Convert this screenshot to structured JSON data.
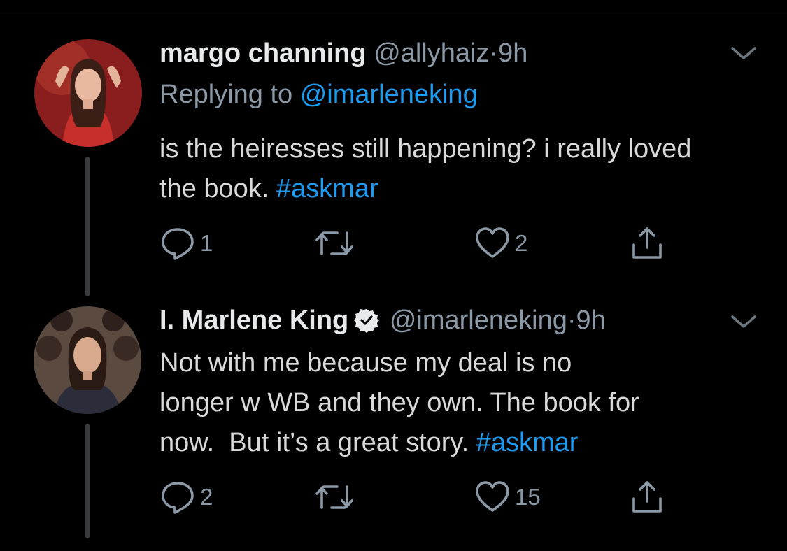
{
  "tweets": [
    {
      "name": "margo channing",
      "handle": "@allyhaiz",
      "sep": "·",
      "time": "9h",
      "replying_prefix": "Replying to",
      "replying_to": "@imarleneking",
      "text": "is the heiresses still happening? i really loved the book.",
      "hashtag": "#askmar",
      "replies": "1",
      "likes": "2"
    },
    {
      "name": "I. Marlene King",
      "handle": "@imarleneking",
      "sep": "·",
      "time": "9h",
      "text_line1": "Not with me because my deal is no",
      "text_line2": "longer w WB and they own. The book for",
      "text_line3": "now.  But it’s a great story.",
      "hashtag": "#askmar",
      "replies": "2",
      "likes": "15"
    }
  ],
  "colors": {
    "background": "#000000",
    "link": "#1d9bf0",
    "muted": "#8b98a5",
    "text": "#d9d9d9"
  },
  "icons": [
    "reply-icon",
    "retweet-icon",
    "like-icon",
    "share-icon",
    "chevron-down-icon",
    "verified-badge-icon"
  ]
}
